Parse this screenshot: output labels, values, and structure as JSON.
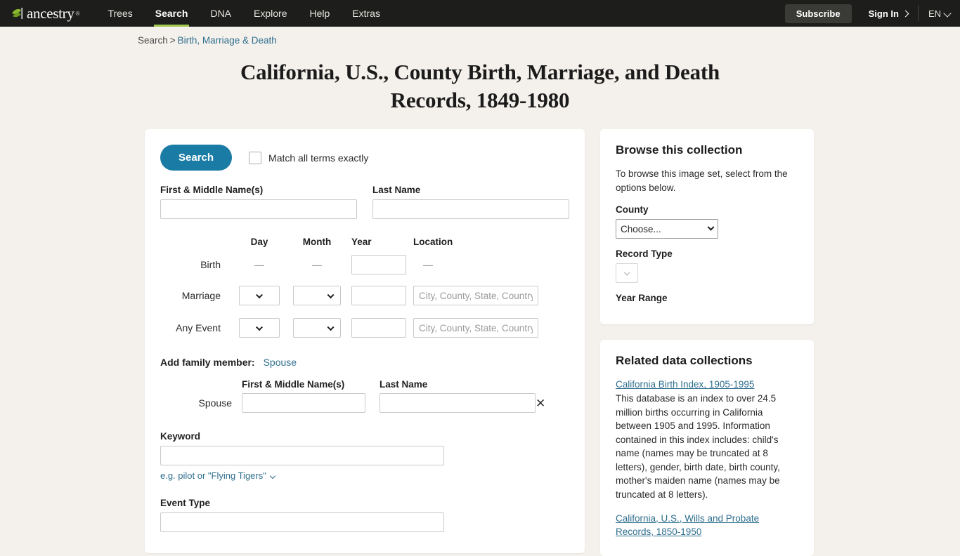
{
  "nav": {
    "logo_text": "ancestry",
    "logo_tm": "®",
    "links": [
      "Trees",
      "Search",
      "DNA",
      "Explore",
      "Help",
      "Extras"
    ],
    "active_link": "Search",
    "subscribe_label": "Subscribe",
    "signin_label": "Sign In",
    "language_label": "EN"
  },
  "breadcrumb": {
    "root": "Search",
    "separator": ">",
    "current": "Birth, Marriage & Death"
  },
  "page_title": "California, U.S., County Birth, Marriage, and Death Records, 1849-1980",
  "form": {
    "search_button": "Search",
    "match_exact_label": "Match all terms exactly",
    "first_name_label": "First & Middle Name(s)",
    "first_name_value": "",
    "last_name_label": "Last Name",
    "last_name_value": "",
    "columns": {
      "day": "Day",
      "month": "Month",
      "year": "Year",
      "location": "Location"
    },
    "rows": [
      {
        "label": "Birth",
        "day": "—",
        "month": "—",
        "year_value": "",
        "location": "—",
        "has_selects": false
      },
      {
        "label": "Marriage",
        "day": "",
        "month": "",
        "year_value": "",
        "location_placeholder": "City, County, State, Country",
        "has_selects": true
      },
      {
        "label": "Any Event",
        "day": "",
        "month": "",
        "year_value": "",
        "location_placeholder": "City, County, State, Country",
        "has_selects": true
      }
    ],
    "family": {
      "add_label": "Add family member:",
      "add_link": "Spouse",
      "col_first": "First & Middle Name(s)",
      "col_last": "Last Name",
      "row_label": "Spouse",
      "first_value": "",
      "last_value": "",
      "remove_icon": "✕"
    },
    "keyword_label": "Keyword",
    "keyword_value": "",
    "keyword_hint": "e.g. pilot or \"Flying Tigers\"",
    "event_type_label": "Event Type",
    "event_type_value": ""
  },
  "browse": {
    "heading": "Browse this collection",
    "intro": "To browse this image set, select from the options below.",
    "county_label": "County",
    "county_value": "Choose...",
    "record_type_label": "Record Type",
    "record_type_value": "",
    "year_range_label": "Year Range"
  },
  "related": {
    "heading": "Related data collections",
    "items": [
      {
        "title": "California Birth Index, 1905-1995",
        "description": "This database is an index to over 24.5 million births occurring in California between 1905 and 1995. Information contained in this index includes: child's name (names may be truncated at 8 letters), gender, birth date, birth county, mother's maiden name (names may be truncated at 8 letters)."
      },
      {
        "title": "California, U.S., Wills and Probate Records, 1850-1950",
        "description": ""
      }
    ]
  },
  "colors": {
    "nav_bg": "#1d1d1b",
    "accent_green": "#9fc54d",
    "link_blue": "#2e6e8e",
    "search_button": "#1a7ca4",
    "page_bg": "#f4f1ec"
  }
}
